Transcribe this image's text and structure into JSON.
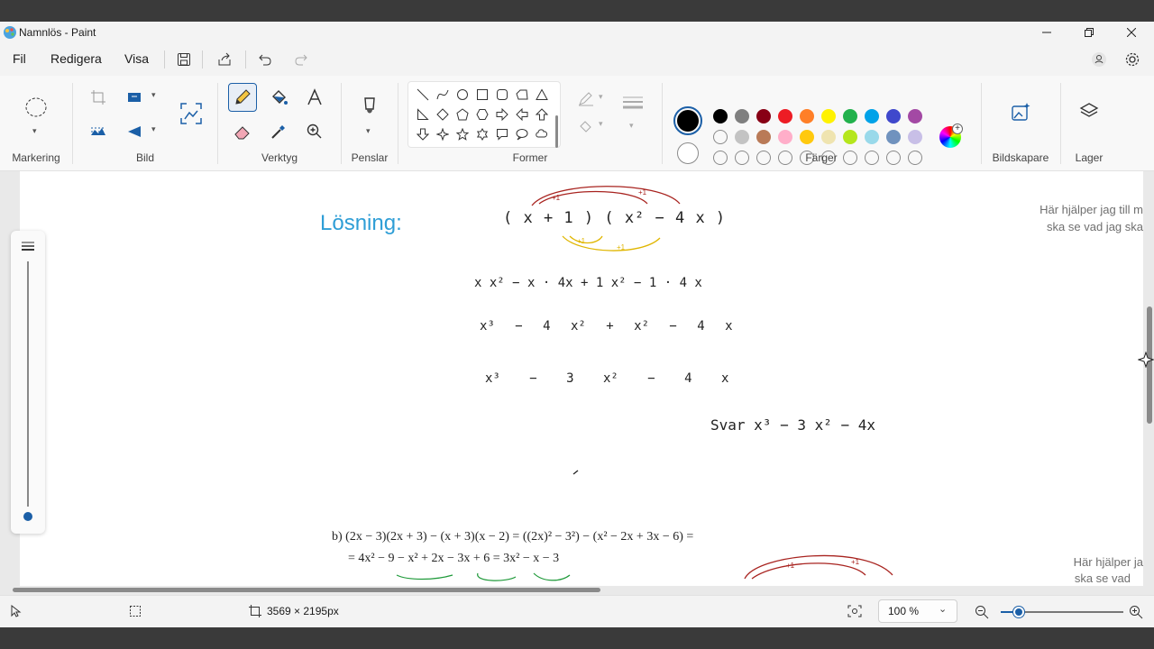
{
  "window": {
    "title": "Namnlös - Paint"
  },
  "menu": {
    "file": "Fil",
    "edit": "Redigera",
    "view": "Visa"
  },
  "ribbon": {
    "groups": {
      "selection": "Markering",
      "image": "Bild",
      "tools": "Verktyg",
      "brushes": "Penslar",
      "shapes": "Former",
      "colors": "Färger",
      "image_creator": "Bildskapare",
      "layers": "Lager"
    },
    "tool_icons": [
      "pencil-icon",
      "fill-icon",
      "text-icon",
      "eraser-icon",
      "color-picker-icon",
      "magnifier-icon"
    ],
    "palette_row1": [
      "#000000",
      "#7f7f7f",
      "#880015",
      "#ed1c24",
      "#ff7f27",
      "#fff200",
      "#22b14c",
      "#00a2e8",
      "#3f48cc",
      "#a349a4"
    ],
    "palette_row2": [
      "#ffffff",
      "#c3c3c3",
      "#b97a57",
      "#ffaec9",
      "#ffc90e",
      "#efe4b0",
      "#b5e61d",
      "#99d9ea",
      "#7092be",
      "#c8bfe7"
    ],
    "primary_color": "#000000",
    "secondary_color": "#ffffff"
  },
  "canvas": {
    "heading": "Lösning:",
    "hint_1_line1": "Här hjälper jag till m",
    "hint_1_line2": "ska se vad jag ska",
    "hint_2_line1": "Här hjälper ja",
    "hint_2_line2": "ska se vad",
    "handwritten": {
      "factors": "( x + 1 ) ( x² − 4 x )",
      "line1": "x x² − x · 4x  + 1 x² − 1 · 4 x",
      "line2": "x³ − 4 x² + x² − 4 x",
      "line3": "x³ − 3 x² − 4 x",
      "answer": "Svar x³ − 3 x² − 4x"
    },
    "typed_b_line1": "b) (2x − 3)(2x + 3) − (x + 3)(x − 2) = ((2x)² − 3²) − (x² − 2x + 3x − 6) =",
    "typed_b_line2": "= 4x² − 9 − x² + 2x − 3x + 6 = 3x² − x − 3"
  },
  "status": {
    "canvas_size": "3569 × 2195px",
    "zoom": "100 %"
  }
}
